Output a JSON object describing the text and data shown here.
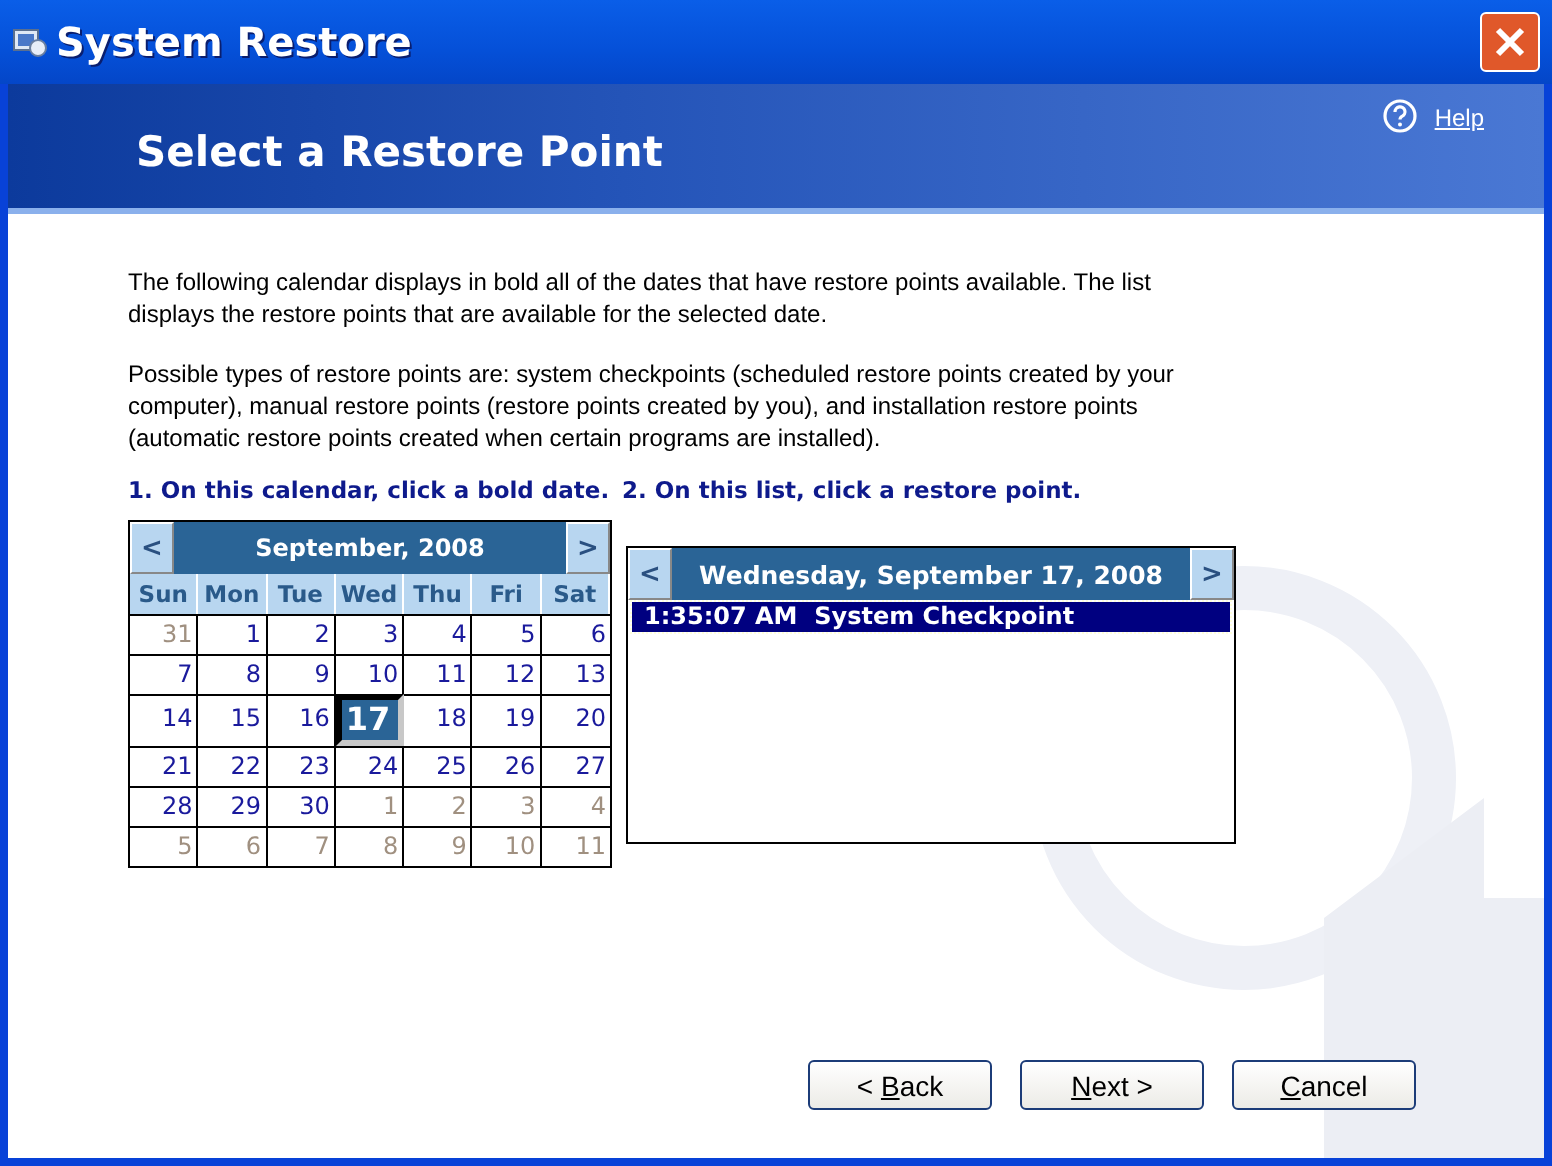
{
  "window": {
    "title": "System Restore"
  },
  "header": {
    "title": "Select a Restore Point",
    "help_link": "Help"
  },
  "intro": [
    "The following calendar displays in bold all of the dates that have restore points available. The list displays the restore points that are available for the selected date.",
    "Possible types of restore points are: system checkpoints (scheduled restore points created by your computer), manual restore points (restore points created by you), and installation restore points (automatic restore points created when certain programs are installed)."
  ],
  "steps": [
    "1. On this calendar, click a bold date.",
    "2. On this list, click a restore point."
  ],
  "calendar": {
    "prev": "<",
    "next": ">",
    "month": "September, 2008",
    "weekdays": [
      "Sun",
      "Mon",
      "Tue",
      "Wed",
      "Thu",
      "Fri",
      "Sat"
    ],
    "weeks": [
      [
        {
          "day": "31",
          "other_month": true,
          "selected": false
        },
        {
          "day": "1",
          "other_month": false,
          "selected": false
        },
        {
          "day": "2",
          "other_month": false,
          "selected": false
        },
        {
          "day": "3",
          "other_month": false,
          "selected": false
        },
        {
          "day": "4",
          "other_month": false,
          "selected": false
        },
        {
          "day": "5",
          "other_month": false,
          "selected": false
        },
        {
          "day": "6",
          "other_month": false,
          "selected": false
        }
      ],
      [
        {
          "day": "7",
          "other_month": false,
          "selected": false
        },
        {
          "day": "8",
          "other_month": false,
          "selected": false
        },
        {
          "day": "9",
          "other_month": false,
          "selected": false
        },
        {
          "day": "10",
          "other_month": false,
          "selected": false
        },
        {
          "day": "11",
          "other_month": false,
          "selected": false
        },
        {
          "day": "12",
          "other_month": false,
          "selected": false
        },
        {
          "day": "13",
          "other_month": false,
          "selected": false
        }
      ],
      [
        {
          "day": "14",
          "other_month": false,
          "selected": false
        },
        {
          "day": "15",
          "other_month": false,
          "selected": false
        },
        {
          "day": "16",
          "other_month": false,
          "selected": false
        },
        {
          "day": "17",
          "other_month": false,
          "selected": true
        },
        {
          "day": "18",
          "other_month": false,
          "selected": false
        },
        {
          "day": "19",
          "other_month": false,
          "selected": false
        },
        {
          "day": "20",
          "other_month": false,
          "selected": false
        }
      ],
      [
        {
          "day": "21",
          "other_month": false,
          "selected": false
        },
        {
          "day": "22",
          "other_month": false,
          "selected": false
        },
        {
          "day": "23",
          "other_month": false,
          "selected": false
        },
        {
          "day": "24",
          "other_month": false,
          "selected": false
        },
        {
          "day": "25",
          "other_month": false,
          "selected": false
        },
        {
          "day": "26",
          "other_month": false,
          "selected": false
        },
        {
          "day": "27",
          "other_month": false,
          "selected": false
        }
      ],
      [
        {
          "day": "28",
          "other_month": false,
          "selected": false
        },
        {
          "day": "29",
          "other_month": false,
          "selected": false
        },
        {
          "day": "30",
          "other_month": false,
          "selected": false
        },
        {
          "day": "1",
          "other_month": true,
          "selected": false
        },
        {
          "day": "2",
          "other_month": true,
          "selected": false
        },
        {
          "day": "3",
          "other_month": true,
          "selected": false
        },
        {
          "day": "4",
          "other_month": true,
          "selected": false
        }
      ],
      [
        {
          "day": "5",
          "other_month": true,
          "selected": false
        },
        {
          "day": "6",
          "other_month": true,
          "selected": false
        },
        {
          "day": "7",
          "other_month": true,
          "selected": false
        },
        {
          "day": "8",
          "other_month": true,
          "selected": false
        },
        {
          "day": "9",
          "other_month": true,
          "selected": false
        },
        {
          "day": "10",
          "other_month": true,
          "selected": false
        },
        {
          "day": "11",
          "other_month": true,
          "selected": false
        }
      ]
    ]
  },
  "restore_list": {
    "prev": "<",
    "next": ">",
    "date": "Wednesday, September 17, 2008",
    "items": [
      {
        "time": "1:35:07 AM",
        "description": "System Checkpoint",
        "selected": true
      }
    ]
  },
  "buttons": [
    {
      "before": "< ",
      "key": "B",
      "after": "ack"
    },
    {
      "key": "N",
      "after": "ext >"
    },
    {
      "key": "C",
      "after": "ancel"
    }
  ]
}
